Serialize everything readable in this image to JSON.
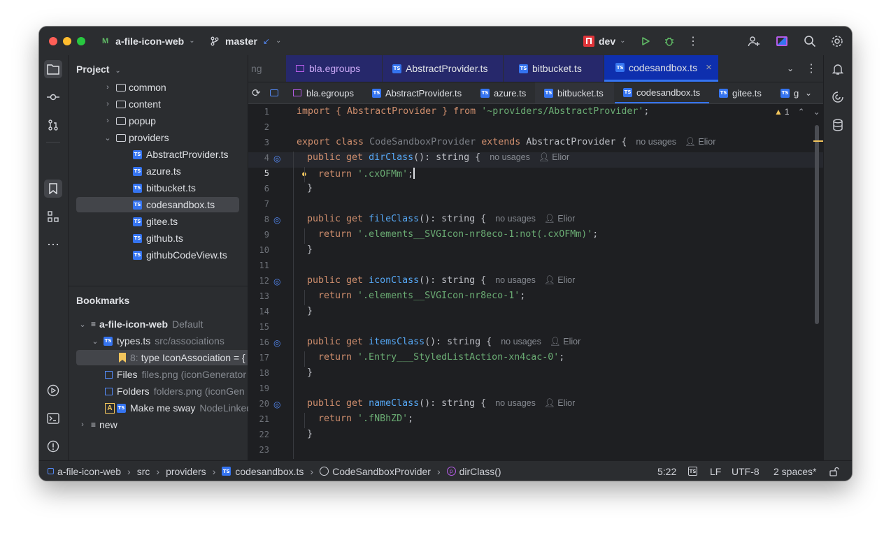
{
  "titlebar": {
    "project_badge": "M",
    "project": "a-file-icon-web",
    "branch": "master",
    "branch_arrow": "↙",
    "run_config": "dev"
  },
  "project_panel": {
    "title": "Project",
    "items": [
      {
        "label": "common"
      },
      {
        "label": "content"
      },
      {
        "label": "popup"
      },
      {
        "label": "providers"
      },
      {
        "label": "AbstractProvider.ts"
      },
      {
        "label": "azure.ts"
      },
      {
        "label": "bitbucket.ts"
      },
      {
        "label": "codesandbox.ts"
      },
      {
        "label": "gitee.ts"
      },
      {
        "label": "github.ts"
      },
      {
        "label": "githubCodeView.ts"
      }
    ]
  },
  "bookmarks": {
    "title": "Bookmarks",
    "root": {
      "label": "a-file-icon-web",
      "tag": "Default"
    },
    "types_file": {
      "label": "types.ts",
      "path": "src/associations"
    },
    "line_bookmark": {
      "line": "8:",
      "text": "type IconAssociation = {"
    },
    "files": {
      "label": "Files",
      "detail": "files.png  (iconGenerator"
    },
    "folders": {
      "label": "Folders",
      "detail": "folders.png  (iconGen"
    },
    "mnemonic": {
      "letter": "A",
      "label": "Make me sway",
      "detail": "NodeLinked"
    },
    "new_group": {
      "label": "new"
    }
  },
  "tabs_top": [
    {
      "label": "ng"
    },
    {
      "label": "bla.egroups"
    },
    {
      "label": "AbstractProvider.ts"
    },
    {
      "label": "bitbucket.ts"
    },
    {
      "label": "codesandbox.ts",
      "close": "×"
    }
  ],
  "tabs_second": [
    {
      "label": "bla.egroups"
    },
    {
      "label": "AbstractProvider.ts"
    },
    {
      "label": "azure.ts"
    },
    {
      "label": "bitbucket.ts"
    },
    {
      "label": "codesandbox.ts"
    },
    {
      "label": "gitee.ts"
    },
    {
      "label": "g"
    }
  ],
  "editor": {
    "warning_count": "1",
    "line_numbers": [
      "1",
      "2",
      "3",
      "4",
      "5",
      "6",
      "7",
      "8",
      "9",
      "10",
      "11",
      "12",
      "13",
      "14",
      "15",
      "16",
      "17",
      "18",
      "19",
      "20",
      "21",
      "22",
      "23"
    ],
    "code": {
      "l1_a": "import { AbstractProvider } ",
      "l1_b": "from",
      "l1_c": " '~providers/AbstractProvider'",
      "l1_d": ";",
      "l3_a": "export class ",
      "l3_b": "CodeSandboxProvider",
      "l3_c": " extends ",
      "l3_d": "AbstractProvider {",
      "l3_usage": "no usages",
      "l3_author": "Elior",
      "get_kw": "public get ",
      "dirClass": "dirClass",
      "fileClass": "fileClass",
      "iconClass": "iconClass",
      "itemsClass": "itemsClass",
      "nameClass": "nameClass",
      "sig_tail": "(): string {",
      "usage": "no usages",
      "author": "Elior",
      "ret_kw": "return ",
      "r5": "'.cxOFMm'",
      "r9": "'.elements__SVGIcon-nr8eco-1:not(.cxOFMm)'",
      "r13": "'.elements__SVGIcon-nr8eco-1'",
      "r17": "'.Entry___StyledListAction-xn4cac-0'",
      "r21": "'.fNBhZD'",
      "semi": ";",
      "close": "}"
    }
  },
  "statusbar": {
    "crumbs": [
      "a-file-icon-web",
      "src",
      "providers",
      "codesandbox.ts",
      "CodeSandboxProvider",
      "dirClass()"
    ],
    "position": "5:22",
    "line_sep": "LF",
    "encoding": "UTF-8",
    "indent": "2 spaces*"
  },
  "colors": {
    "accent": "#3574f0",
    "keyword": "#cf8e6d",
    "string": "#6aab73",
    "function": "#56a8f5"
  }
}
